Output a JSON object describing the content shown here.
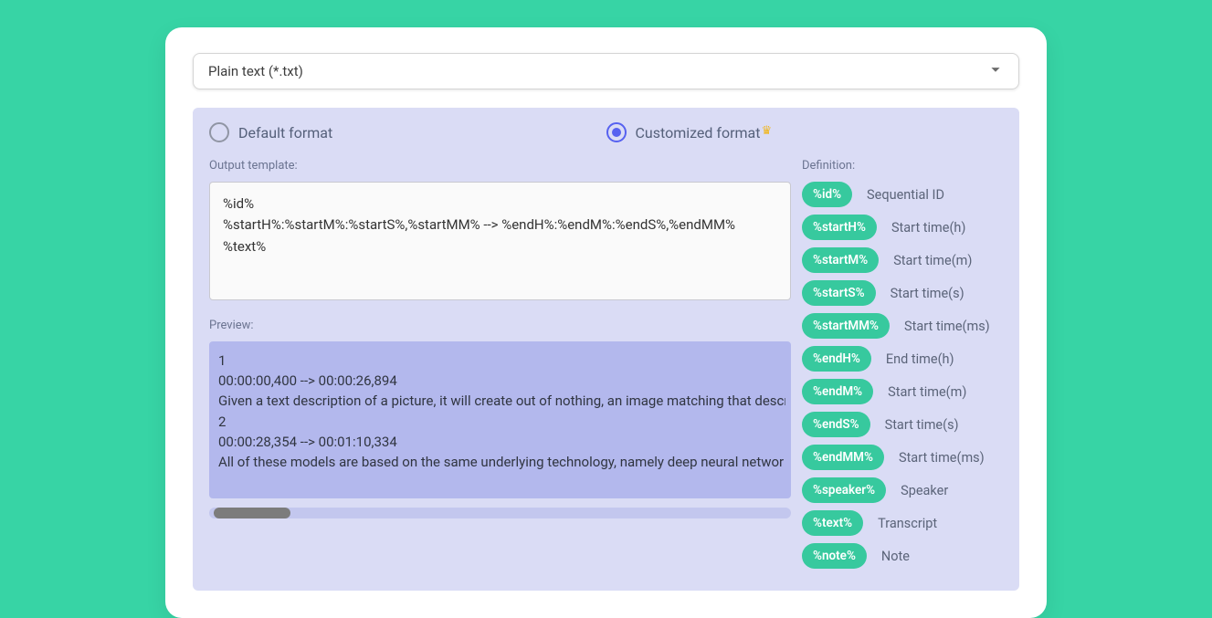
{
  "select": {
    "value": "Plain text (*.txt)"
  },
  "radios": {
    "default": "Default format",
    "custom": "Customized format"
  },
  "labels": {
    "output_template": "Output template:",
    "preview": "Preview:",
    "definition": "Definition:"
  },
  "template_value": "%id%\n%startH%:%startM%:%startS%,%startMM% --> %endH%:%endM%:%endS%,%endMM%\n%text%",
  "preview_lines": [
    "1",
    "00:00:00,400 --> 00:00:26,894",
    "Given a text description of a picture, it will create out of nothing, an image matching that descr",
    "2",
    "00:00:28,354 --> 00:01:10,334",
    "All of these models are based on the same underlying technology, namely deep neural networ"
  ],
  "definitions": [
    {
      "token": "%id%",
      "desc": "Sequential ID"
    },
    {
      "token": "%startH%",
      "desc": "Start time(h)"
    },
    {
      "token": "%startM%",
      "desc": "Start time(m)"
    },
    {
      "token": "%startS%",
      "desc": "Start time(s)"
    },
    {
      "token": "%startMM%",
      "desc": "Start time(ms)"
    },
    {
      "token": "%endH%",
      "desc": "End time(h)"
    },
    {
      "token": "%endM%",
      "desc": "Start time(m)"
    },
    {
      "token": "%endS%",
      "desc": "Start time(s)"
    },
    {
      "token": "%endMM%",
      "desc": "Start time(ms)"
    },
    {
      "token": "%speaker%",
      "desc": "Speaker"
    },
    {
      "token": "%text%",
      "desc": "Transcript"
    },
    {
      "token": "%note%",
      "desc": "Note"
    }
  ]
}
